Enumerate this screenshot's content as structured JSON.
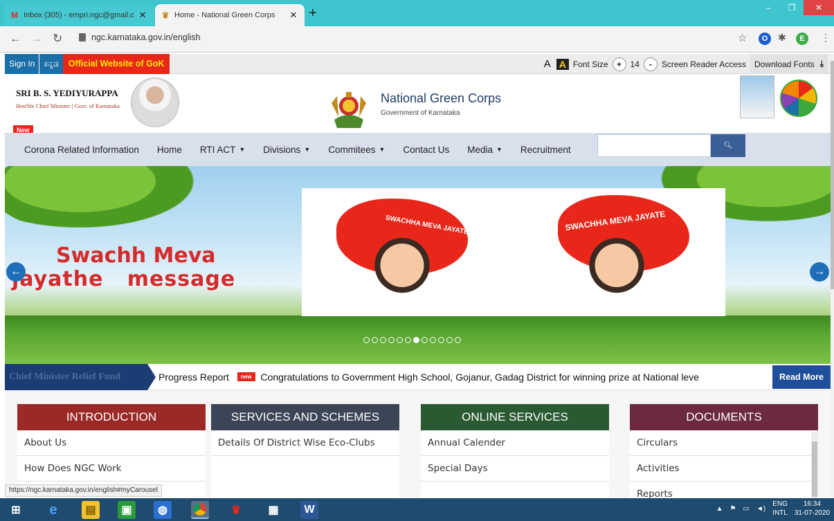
{
  "browser": {
    "tabs": [
      {
        "title": "Inbox (305) - empri.ngc@gmail.c",
        "favicon": "gmail-icon",
        "active": false
      },
      {
        "title": "Home - National Green Corps",
        "favicon": "emblem-icon",
        "active": true
      }
    ],
    "url": "ngc.karnataka.gov.in/english",
    "status_url": "https://ngc.karnataka.gov.in/english#myCarousel",
    "profile_initial": "E"
  },
  "topstrip": {
    "sign_in": "Sign In",
    "kannada": "ಕನ್ನಡ",
    "official": "Official Website of GoK",
    "a_normal": "A",
    "a_contrast": "A",
    "font_size_label": "Font Size",
    "plus": "+",
    "font_size_value": "14",
    "minus": "-",
    "screen_reader": "Screen Reader Access",
    "download_fonts": "Download Fonts"
  },
  "header": {
    "cm_name": "SRI B. S. YEDIYURAPPA",
    "cm_title": "Hon'ble Chief Minister | Govt. of Karnataka",
    "new_badge": "New",
    "site_title": "National Green Corps",
    "site_subtitle": "Government of Karnataka"
  },
  "nav": {
    "items": [
      {
        "label": "Corona Related Information",
        "dropdown": false
      },
      {
        "label": "Home",
        "dropdown": false
      },
      {
        "label": "RTI ACT",
        "dropdown": true
      },
      {
        "label": "Divisions",
        "dropdown": true
      },
      {
        "label": "Commitees",
        "dropdown": true
      },
      {
        "label": "Contact Us",
        "dropdown": false
      },
      {
        "label": "Media",
        "dropdown": true
      },
      {
        "label": "Recruitment",
        "dropdown": false
      }
    ],
    "search_value": ""
  },
  "carousel": {
    "line1": "Swachh Meva",
    "line2": "jayathe   message",
    "badge_left": "SWACHHA MEVA JAYATE",
    "badge_right": "SWACHHA MEVA JAYATE",
    "slide_count": 12,
    "active_slide": 7
  },
  "ticker": {
    "label": "Chief Minister Relief Fund",
    "item1": "Progress Report",
    "new_tag": "new",
    "item2": "Congratulations to Government High School, Gojanur, Gadag District for winning prize at National leve",
    "read_more": "Read More"
  },
  "panels": [
    {
      "title": "INTRODUCTION",
      "color": "#9b2a27",
      "items": [
        "About Us",
        "How Does NGC Work"
      ]
    },
    {
      "title": "SERVICES AND SCHEMES",
      "color": "#3b4556",
      "items": [
        "Details Of District Wise Eco-Clubs"
      ]
    },
    {
      "title": "ONLINE SERVICES",
      "color": "#2a5a31",
      "items": [
        "Annual Calender",
        "Special Days"
      ]
    },
    {
      "title": "DOCUMENTS",
      "color": "#6b2942",
      "items": [
        "Circulars",
        "Activities",
        "Reports"
      ]
    }
  ],
  "taskbar": {
    "lang1": "ENG",
    "lang2": "INTL",
    "time": "16:34",
    "date": "31-07-2020"
  }
}
